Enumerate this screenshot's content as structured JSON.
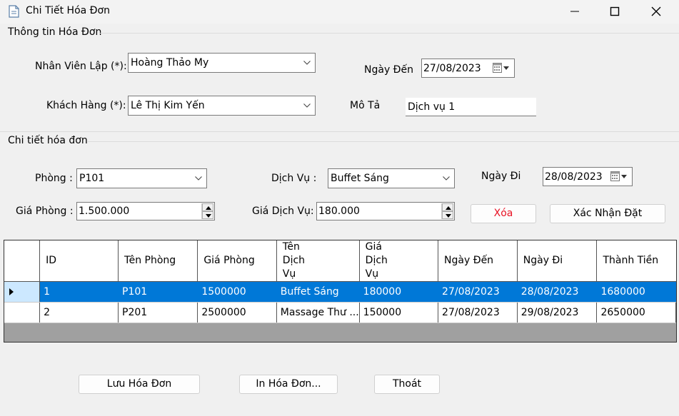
{
  "window": {
    "title": "Chi Tiết Hóa Đơn",
    "icons": [
      "document-icon",
      "minimize-icon",
      "maximize-icon",
      "close-icon"
    ]
  },
  "invoice_info": {
    "group_label": "Thông tin Hóa Đơn",
    "employee_label": "Nhân Viên Lập (*):",
    "employee_value": "Hoàng Thảo My",
    "arrival_label": "Ngày Đến",
    "arrival_value": "27/08/2023",
    "customer_label": "Khách Hàng (*):",
    "customer_value": "Lê Thị Kim Yến",
    "description_label": "Mô Tả",
    "description_value": "Dịch vụ 1"
  },
  "detail": {
    "group_label": "Chi tiết hóa đơn",
    "room_label": "Phòng :",
    "room_value": "P101",
    "service_label": "Dịch Vụ :",
    "service_value": "Buffet Sáng",
    "departure_label": "Ngày Đi",
    "departure_value": "28/08/2023",
    "room_price_label": "Giá Phòng :",
    "room_price_value": "1.500.000",
    "service_price_label": "Giá Dịch Vụ:",
    "service_price_value": "180.000",
    "delete_label": "Xóa",
    "confirm_label": "Xác Nhận Đặt"
  },
  "grid": {
    "columns": [
      "ID",
      "Tên Phòng",
      "Giá Phòng",
      "Tên Dịch Vụ",
      "Giá Dịch Vụ",
      "Ngày Đến",
      "Ngày Đi",
      "Thành Tiền"
    ],
    "rows": [
      [
        "1",
        "P101",
        "1500000",
        "Buffet Sáng",
        "180000",
        "27/08/2023",
        "28/08/2023",
        "1680000"
      ],
      [
        "2",
        "P201",
        "2500000",
        "Massage Thư ...",
        "150000",
        "27/08/2023",
        "29/08/2023",
        "2650000"
      ]
    ],
    "selected_row": 0
  },
  "footer": {
    "save_label": "Lưu Hóa Đơn",
    "print_label": "In Hóa Đơn...",
    "exit_label": "Thoát"
  },
  "colors": {
    "selection": "#0078d7",
    "delete_text": "#e81123",
    "empty_grid": "#a0a0a0"
  }
}
